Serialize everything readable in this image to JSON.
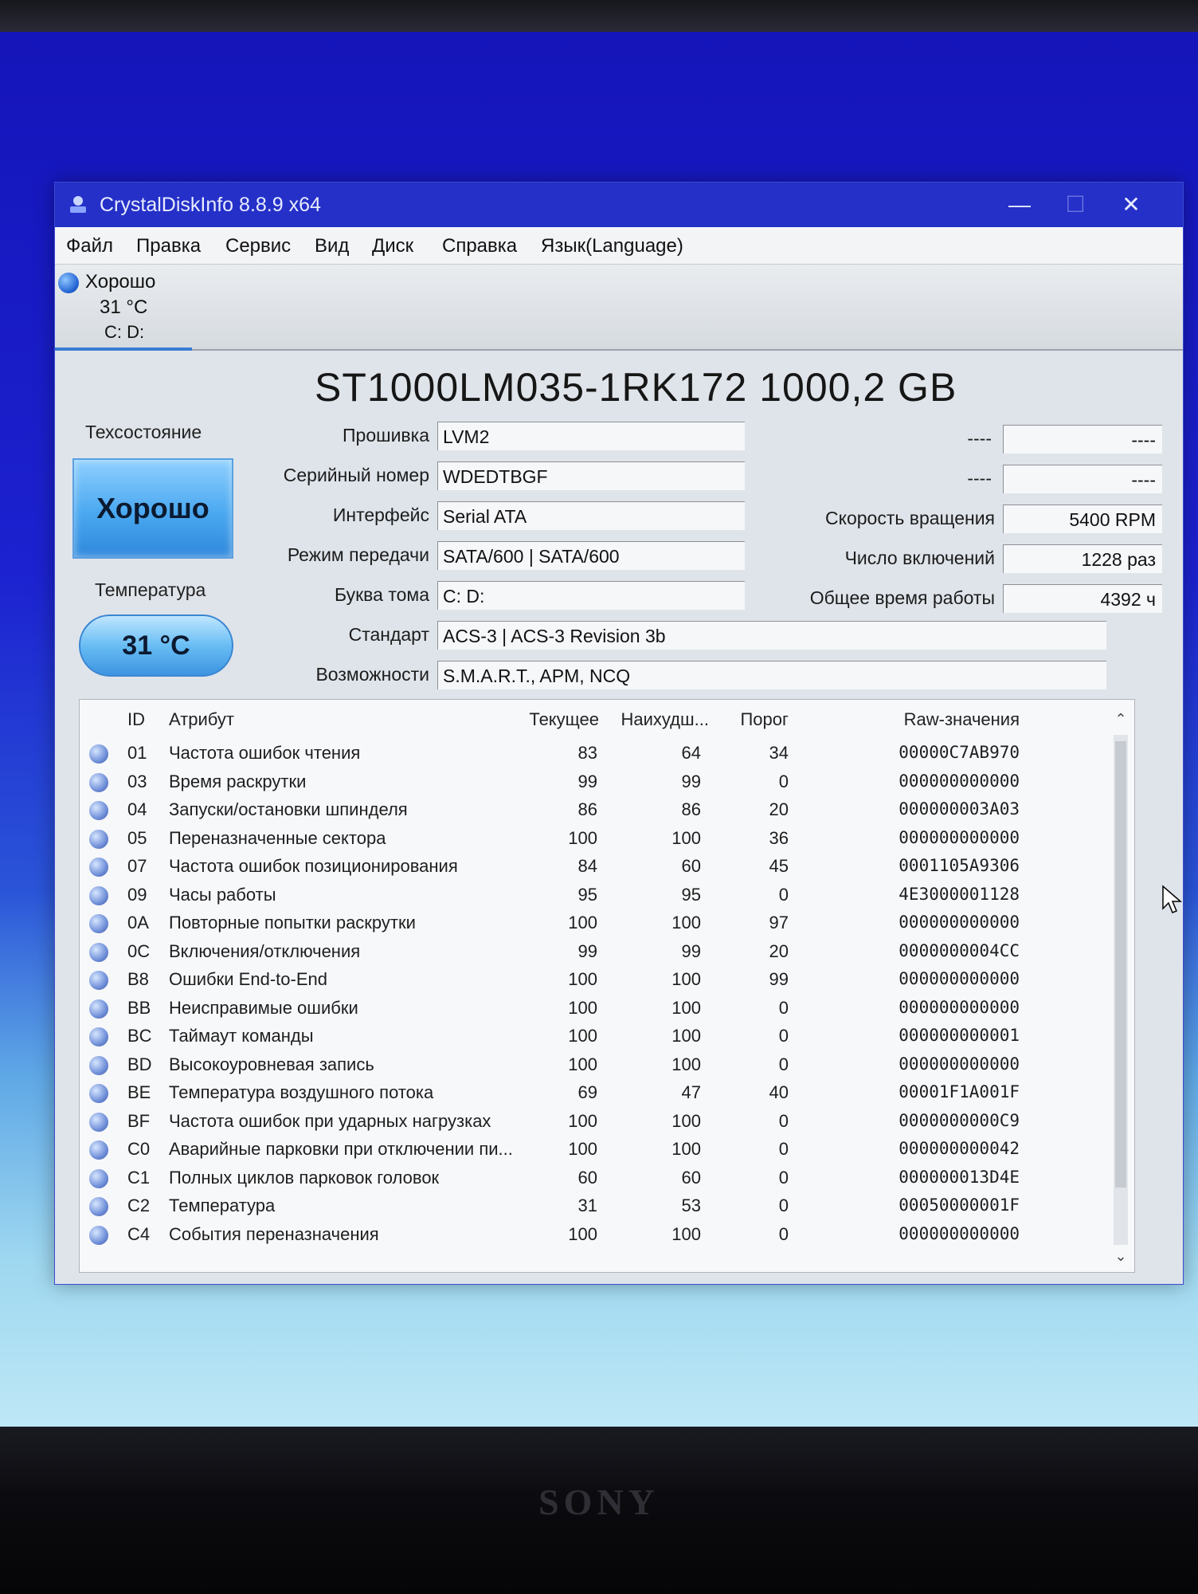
{
  "window": {
    "title": "CrystalDiskInfo 8.8.9 x64",
    "controls": {
      "minimize": "—",
      "maximize": "☐",
      "close": "✕"
    }
  },
  "menu": [
    "Файл",
    "Правка",
    "Сервис",
    "Вид",
    "Диск",
    "Справка",
    "Язык(Language)"
  ],
  "disk_tab": {
    "status": "Хорошо",
    "temperature": "31 °C",
    "letters": "C: D:"
  },
  "disk_title": "ST1000LM035-1RK172 1000,2 GB",
  "health": {
    "label": "Техсостояние",
    "value": "Хорошо"
  },
  "temperature": {
    "label": "Температура",
    "value": "31 °C"
  },
  "fields": {
    "firmware": {
      "label": "Прошивка",
      "value": "LVM2"
    },
    "serial": {
      "label": "Серийный номер",
      "value": "WDEDTBGF"
    },
    "interface": {
      "label": "Интерфейс",
      "value": "Serial ATA"
    },
    "transfer": {
      "label": "Режим передачи",
      "value": "SATA/600 | SATA/600"
    },
    "volume": {
      "label": "Буква тома",
      "value": "C: D:"
    },
    "standard": {
      "label": "Стандарт",
      "value": "ACS-3 | ACS-3 Revision 3b"
    },
    "features": {
      "label": "Возможности",
      "value": "S.M.A.R.T., APM, NCQ"
    }
  },
  "right_fields": {
    "extra1": {
      "label": "----",
      "value": "----"
    },
    "extra2": {
      "label": "----",
      "value": "----"
    },
    "rotation": {
      "label": "Скорость вращения",
      "value": "5400 RPM"
    },
    "power_count": {
      "label": "Число включений",
      "value": "1228 раз"
    },
    "power_hours": {
      "label": "Общее время работы",
      "value": "4392 ч"
    }
  },
  "smart": {
    "columns": {
      "id": "ID",
      "attr": "Атрибут",
      "current": "Текущее",
      "worst": "Наихудш...",
      "threshold": "Порог",
      "raw": "Raw-значения"
    },
    "rows": [
      {
        "id": "01",
        "attr": "Частота ошибок чтения",
        "current": "83",
        "worst": "64",
        "threshold": "34",
        "raw": "00000C7AB970"
      },
      {
        "id": "03",
        "attr": "Время раскрутки",
        "current": "99",
        "worst": "99",
        "threshold": "0",
        "raw": "000000000000"
      },
      {
        "id": "04",
        "attr": "Запуски/остановки шпинделя",
        "current": "86",
        "worst": "86",
        "threshold": "20",
        "raw": "000000003A03"
      },
      {
        "id": "05",
        "attr": "Переназначенные сектора",
        "current": "100",
        "worst": "100",
        "threshold": "36",
        "raw": "000000000000"
      },
      {
        "id": "07",
        "attr": "Частота ошибок позиционирования",
        "current": "84",
        "worst": "60",
        "threshold": "45",
        "raw": "0001105A9306"
      },
      {
        "id": "09",
        "attr": "Часы работы",
        "current": "95",
        "worst": "95",
        "threshold": "0",
        "raw": "4E3000001128"
      },
      {
        "id": "0A",
        "attr": "Повторные попытки раскрутки",
        "current": "100",
        "worst": "100",
        "threshold": "97",
        "raw": "000000000000"
      },
      {
        "id": "0C",
        "attr": "Включения/отключения",
        "current": "99",
        "worst": "99",
        "threshold": "20",
        "raw": "0000000004CC"
      },
      {
        "id": "B8",
        "attr": "Ошибки End-to-End",
        "current": "100",
        "worst": "100",
        "threshold": "99",
        "raw": "000000000000"
      },
      {
        "id": "BB",
        "attr": "Неисправимые ошибки",
        "current": "100",
        "worst": "100",
        "threshold": "0",
        "raw": "000000000000"
      },
      {
        "id": "BC",
        "attr": "Таймаут команды",
        "current": "100",
        "worst": "100",
        "threshold": "0",
        "raw": "000000000001"
      },
      {
        "id": "BD",
        "attr": "Высокоуровневая запись",
        "current": "100",
        "worst": "100",
        "threshold": "0",
        "raw": "000000000000"
      },
      {
        "id": "BE",
        "attr": "Температура воздушного потока",
        "current": "69",
        "worst": "47",
        "threshold": "40",
        "raw": "00001F1A001F"
      },
      {
        "id": "BF",
        "attr": "Частота ошибок при ударных нагрузках",
        "current": "100",
        "worst": "100",
        "threshold": "0",
        "raw": "0000000000C9"
      },
      {
        "id": "C0",
        "attr": "Аварийные парковки при отключении пи...",
        "current": "100",
        "worst": "100",
        "threshold": "0",
        "raw": "000000000042"
      },
      {
        "id": "C1",
        "attr": "Полных циклов парковок головок",
        "current": "60",
        "worst": "60",
        "threshold": "0",
        "raw": "000000013D4E"
      },
      {
        "id": "C2",
        "attr": "Температура",
        "current": "31",
        "worst": "53",
        "threshold": "0",
        "raw": "00050000001F"
      },
      {
        "id": "C4",
        "attr": "События переназначения",
        "current": "100",
        "worst": "100",
        "threshold": "0",
        "raw": "000000000000"
      }
    ]
  },
  "bezel_brand": "SONY"
}
